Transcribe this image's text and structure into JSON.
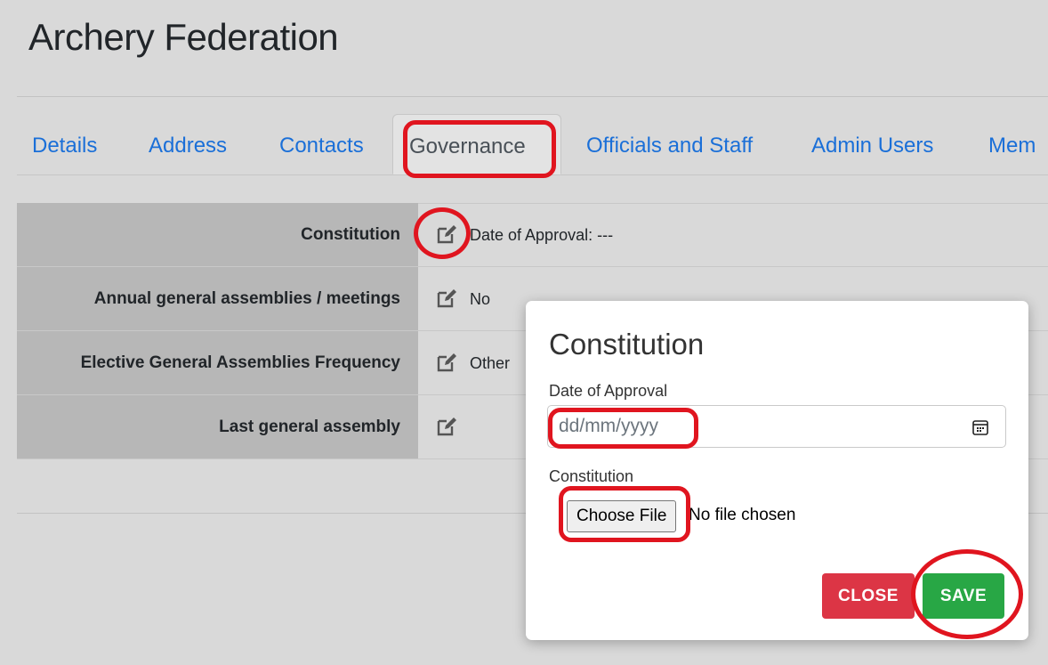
{
  "header": {
    "title": "Archery Federation"
  },
  "tabs": [
    {
      "label": "Details"
    },
    {
      "label": "Address"
    },
    {
      "label": "Contacts"
    },
    {
      "label": "Governance"
    },
    {
      "label": "Officials and Staff"
    },
    {
      "label": "Admin Users"
    },
    {
      "label": "Mem"
    }
  ],
  "governance": {
    "rows": [
      {
        "label": "Constitution",
        "value": "Date of Approval: ---"
      },
      {
        "label": "Annual general assemblies / meetings",
        "value": "No"
      },
      {
        "label": "Elective General Assemblies Frequency",
        "value": "Other"
      },
      {
        "label": "Last general assembly",
        "value": ""
      }
    ]
  },
  "modal": {
    "title": "Constitution",
    "date_label": "Date of Approval",
    "date_placeholder": "dd/mm/yyyy",
    "file_label": "Constitution",
    "file_button": "Choose File",
    "file_status": "No file chosen",
    "close_label": "CLOSE",
    "save_label": "SAVE"
  },
  "icons": {
    "edit": "edit-icon",
    "calendar": "calendar-icon"
  },
  "colors": {
    "link": "#1a6fd8",
    "close": "#dc3545",
    "save": "#28a745",
    "annotation": "#e0151f"
  }
}
